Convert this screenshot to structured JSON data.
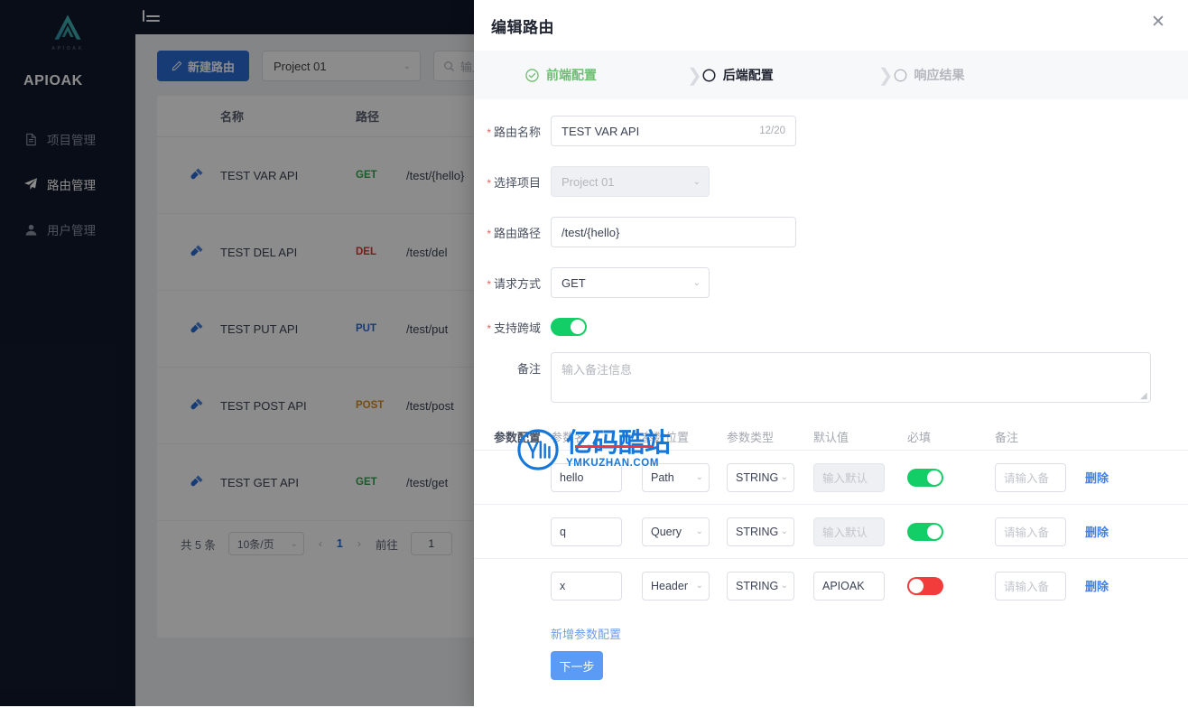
{
  "app": {
    "brand": "APIOAK",
    "logo_sub": "APIOAK"
  },
  "sidebar": {
    "items": [
      {
        "label": "项目管理",
        "icon": "document-icon",
        "active": false
      },
      {
        "label": "路由管理",
        "icon": "paper-plane-icon",
        "active": true
      },
      {
        "label": "用户管理",
        "icon": "user-icon",
        "active": false
      }
    ]
  },
  "topbar": {
    "menu_toggle_icon": "hamburger-collapse-icon"
  },
  "toolbar": {
    "new_route_label": "新建路由",
    "new_route_icon": "pencil-icon",
    "project_select_value": "Project 01",
    "search_placeholder": "输入",
    "search_icon": "search-icon"
  },
  "table": {
    "columns": {
      "name": "名称",
      "path": "路径"
    },
    "rows": [
      {
        "icon": "plug-icon",
        "name": "TEST VAR API",
        "method": "GET",
        "method_color": "#2fa84f",
        "path": "/test/{hello}"
      },
      {
        "icon": "plug-icon",
        "name": "TEST DEL API",
        "method": "DEL",
        "method_color": "#d93a3a",
        "path": "/test/del"
      },
      {
        "icon": "plug-icon",
        "name": "TEST PUT API",
        "method": "PUT",
        "method_color": "#2b6cd4",
        "path": "/test/put"
      },
      {
        "icon": "plug-icon",
        "name": "TEST POST API",
        "method": "POST",
        "method_color": "#d98a1e",
        "path": "/test/post"
      },
      {
        "icon": "plug-icon",
        "name": "TEST GET API",
        "method": "GET",
        "method_color": "#2fa84f",
        "path": "/test/get"
      }
    ]
  },
  "pagination": {
    "total": "共 5 条",
    "page_size": "10条/页",
    "prev_icon": "chevron-left-icon",
    "next_icon": "chevron-right-icon",
    "current_page": "1",
    "goto_label": "前往",
    "goto_value": "1"
  },
  "modal": {
    "title": "编辑路由",
    "close_icon": "close-icon",
    "steps": [
      {
        "label": "前端配置",
        "state": "done",
        "icon": "check-circle-icon"
      },
      {
        "label": "后端配置",
        "state": "current",
        "icon": "circle-icon"
      },
      {
        "label": "响应结果",
        "state": "todo",
        "icon": "circle-icon"
      }
    ],
    "form": {
      "route_name": {
        "label": "路由名称",
        "required": true,
        "value": "TEST VAR API",
        "counter": "12/20"
      },
      "project": {
        "label": "选择项目",
        "required": true,
        "value": "Project 01",
        "disabled": true
      },
      "route_path": {
        "label": "路由路径",
        "required": true,
        "value": "/test/{hello}"
      },
      "method": {
        "label": "请求方式",
        "required": true,
        "value": "GET"
      },
      "cors": {
        "label": "支持跨域",
        "required": true,
        "enabled": true
      },
      "remark": {
        "label": "备注",
        "required": false,
        "placeholder": "输入备注信息",
        "value": ""
      }
    },
    "params": {
      "section_label": "参数配置",
      "columns": [
        "参数名",
        "参数位置",
        "参数类型",
        "默认值",
        "必填",
        "备注"
      ],
      "rows": [
        {
          "name": "hello",
          "position": "Path",
          "type": "STRING",
          "default": "",
          "default_placeholder": "输入默认",
          "required": true,
          "note": "",
          "note_placeholder": "请输入备",
          "delete_label": "删除"
        },
        {
          "name": "q",
          "position": "Query",
          "type": "STRING",
          "default": "",
          "default_placeholder": "输入默认",
          "required": true,
          "note": "",
          "note_placeholder": "请输入备",
          "delete_label": "删除"
        },
        {
          "name": "x",
          "position": "Header",
          "type": "STRING",
          "default": "APIOAK",
          "default_placeholder": "",
          "required": false,
          "note": "",
          "note_placeholder": "请输入备",
          "delete_label": "删除"
        }
      ],
      "add_label": "新增参数配置"
    },
    "next_button": "下一步"
  },
  "watermark": {
    "cn": "亿码酷站",
    "en": "YMKUZHAN.COM"
  },
  "colors": {
    "primary": "#2b6cd4",
    "sidebar_bg": "#11192c",
    "toggle_on": "#13ce66",
    "toggle_off": "#f23c3c",
    "link": "#3b82f6",
    "watermark": "#1677d9"
  }
}
